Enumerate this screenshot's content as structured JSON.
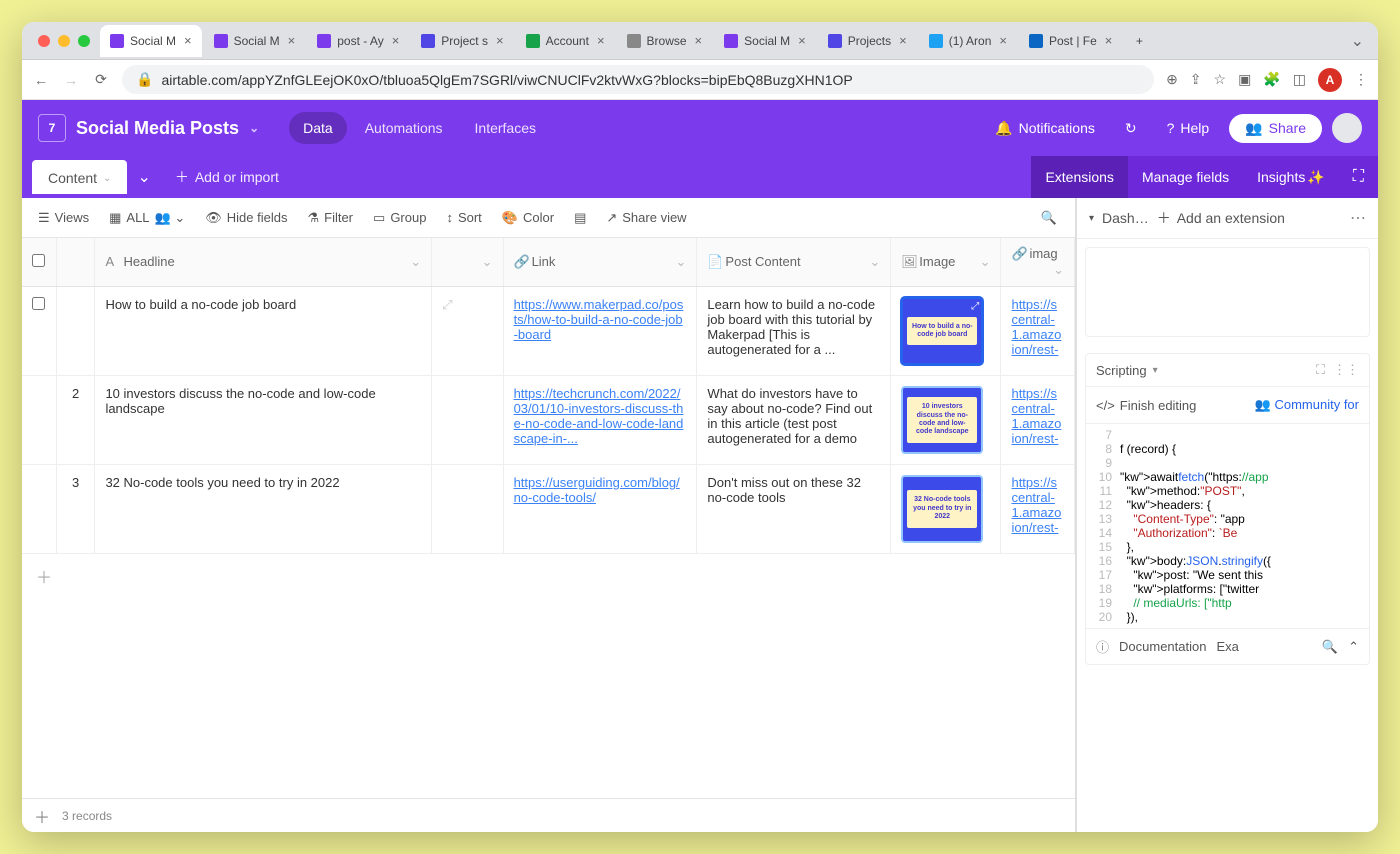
{
  "browser": {
    "tabs": [
      {
        "label": "Social M",
        "favicon": "#7c3aed",
        "active": true
      },
      {
        "label": "Social M",
        "favicon": "#7c3aed"
      },
      {
        "label": "post - Ay",
        "favicon": "#7c3aed"
      },
      {
        "label": "Project s",
        "favicon": "#4f46e5"
      },
      {
        "label": "Account",
        "favicon": "#16a34a"
      },
      {
        "label": "Browse",
        "favicon": "#888"
      },
      {
        "label": "Social M",
        "favicon": "#7c3aed"
      },
      {
        "label": "Projects",
        "favicon": "#4f46e5"
      },
      {
        "label": "(1) Aron",
        "favicon": "#1da1f2"
      },
      {
        "label": "Post | Fe",
        "favicon": "#0a66c2"
      }
    ],
    "url": "airtable.com/appYZnfGLEejOK0xO/tbluoa5QlgEm7SGRl/viwCNUClFv2ktvWxG?blocks=bipEbQ8BuzgXHN1OP",
    "avatar_letter": "A"
  },
  "header": {
    "base_title": "Social Media Posts",
    "tabs": [
      "Data",
      "Automations",
      "Interfaces"
    ],
    "active_tab": "Data",
    "notifications": "Notifications",
    "history_icon": "history",
    "help": "Help",
    "share": "Share"
  },
  "table_row": {
    "table_name": "Content",
    "add_or_import": "Add or import",
    "right_tabs": [
      "Extensions",
      "Manage fields",
      "Insights"
    ],
    "right_tabs_active": "Extensions"
  },
  "view_toolbar": {
    "views": "Views",
    "grid": "ALL",
    "hide_fields": "Hide fields",
    "filter": "Filter",
    "group": "Group",
    "sort": "Sort",
    "color": "Color",
    "row_height": "",
    "share_view": "Share view"
  },
  "columns": [
    "",
    "",
    "Headline",
    "",
    "Link",
    "Post Content",
    "Image",
    "imag"
  ],
  "rows": [
    {
      "num": "",
      "headline": "How to build a no-code job board",
      "link": "https://www.makerpad.co/posts/how-to-build-a-no-code-job-board",
      "content": "Learn how to build a no-code job board with this tutorial by Makerpad [This is autogenerated for a ...",
      "image_text": "How to build a no-code job board",
      "image_url": "https://s central-1.amazo ion/rest-",
      "selected": true
    },
    {
      "num": "2",
      "headline": "10 investors discuss the no-code and low-code landscape",
      "link": "https://techcrunch.com/2022/03/01/10-investors-discuss-the-no-code-and-low-code-landscape-in-...",
      "content": "What do investors have to say about no-code? Find out in this article (test post autogenerated for a demo",
      "image_text": "10 investors discuss the no-code and low-code landscape",
      "image_url": "https://s central-1.amazo ion/rest-"
    },
    {
      "num": "3",
      "headline": "32 No-code tools you need to try in 2022",
      "link": "https://userguiding.com/blog/no-code-tools/",
      "content": "Don't miss out on these 32 no-code tools",
      "image_text": "32 No-code tools you need to try in 2022",
      "image_url": "https://s central-1.amazo ion/rest-"
    }
  ],
  "footer": {
    "records": "3 records"
  },
  "extensions": {
    "dashboard_label": "Dash…",
    "add_extension": "Add an extension",
    "scripting_block": "Scripting",
    "finish_editing": "Finish editing",
    "community": "Community for",
    "code": [
      {
        "n": "7",
        "t": ""
      },
      {
        "n": "8",
        "t": "f (record) {"
      },
      {
        "n": "9",
        "t": ""
      },
      {
        "n": "10",
        "t": "await fetch(\"https://app"
      },
      {
        "n": "11",
        "t": "  method: \"POST\","
      },
      {
        "n": "12",
        "t": "  headers: {"
      },
      {
        "n": "13",
        "t": "    \"Content-Type\": \"app"
      },
      {
        "n": "14",
        "t": "    \"Authorization\": `Be"
      },
      {
        "n": "15",
        "t": "  },"
      },
      {
        "n": "16",
        "t": "  body: JSON.stringify({"
      },
      {
        "n": "17",
        "t": "    post: \"We sent this "
      },
      {
        "n": "18",
        "t": "    platforms: [\"twitter"
      },
      {
        "n": "19",
        "t": "    // mediaUrls: [\"http"
      },
      {
        "n": "20",
        "t": "  }),"
      }
    ],
    "documentation": "Documentation",
    "examples": "Exa"
  }
}
